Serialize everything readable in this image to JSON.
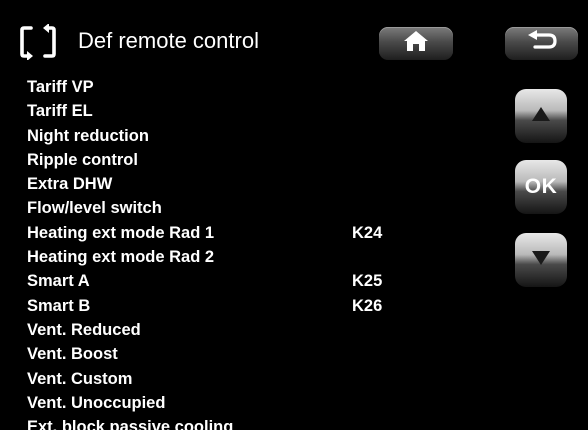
{
  "header": {
    "title": "Def remote control",
    "icon": "remote-control-swap-icon"
  },
  "nav": {
    "home_icon": "home-icon",
    "back_icon": "back-arrow-icon"
  },
  "side_buttons": {
    "up_icon": "triangle-up-icon",
    "ok_label": "OK",
    "down_icon": "triangle-down-icon"
  },
  "list": [
    {
      "label": "Tariff VP",
      "value": ""
    },
    {
      "label": "Tariff EL",
      "value": ""
    },
    {
      "label": "Night reduction",
      "value": ""
    },
    {
      "label": "Ripple control",
      "value": ""
    },
    {
      "label": "Extra DHW",
      "value": ""
    },
    {
      "label": "Flow/level switch",
      "value": ""
    },
    {
      "label": "Heating ext mode Rad 1",
      "value": "K24"
    },
    {
      "label": "Heating ext mode Rad 2",
      "value": ""
    },
    {
      "label": "Smart A",
      "value": "K25"
    },
    {
      "label": "Smart B",
      "value": "K26"
    },
    {
      "label": "Vent. Reduced",
      "value": ""
    },
    {
      "label": "Vent. Boost",
      "value": ""
    },
    {
      "label": "Vent. Custom",
      "value": ""
    },
    {
      "label": "Vent. Unoccupied",
      "value": ""
    },
    {
      "label": "Ext. block passive cooling",
      "value": ""
    }
  ],
  "colors": {
    "background": "#000000",
    "text": "#ffffff",
    "button_dark": "#4a4a4a",
    "button_light": "#e8e8e8"
  }
}
